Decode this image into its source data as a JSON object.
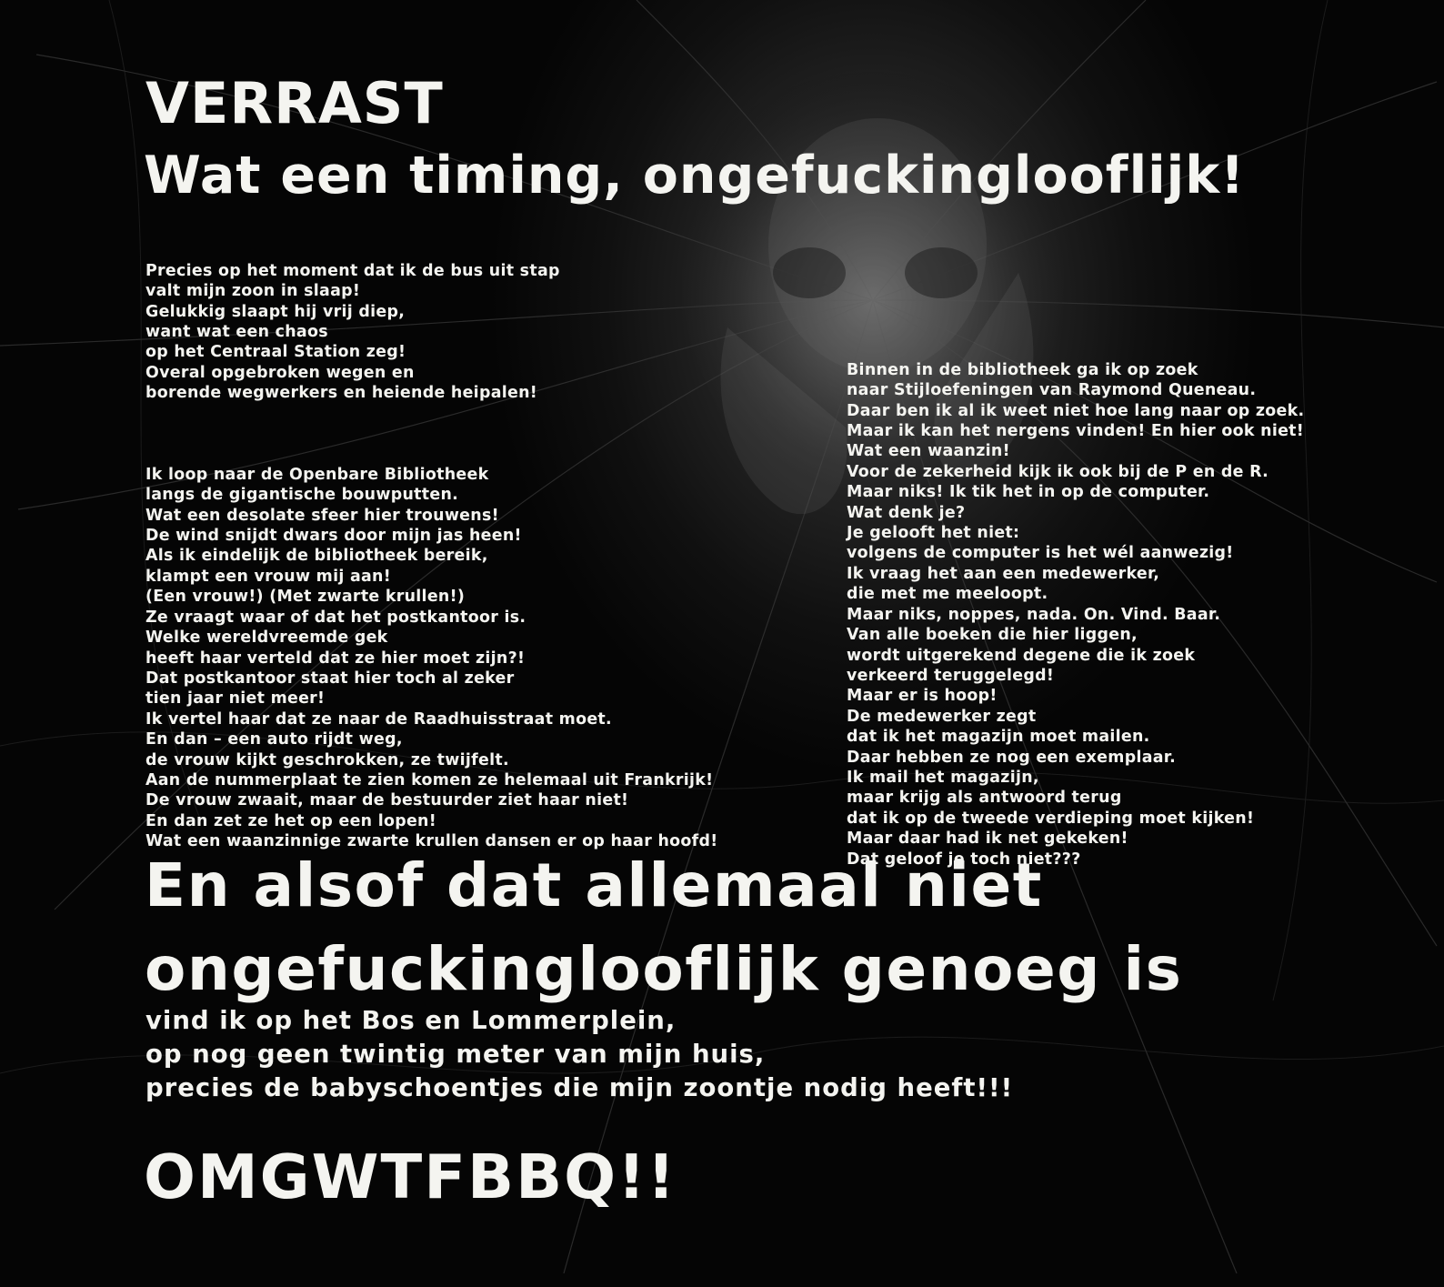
{
  "poster": {
    "kicker": "VERRAST",
    "headline": "Wat een timing, ongefuckinglooflijk!",
    "left_column": [
      "Precies op het moment dat ik de bus uit stap\nvalt mijn zoon in slaap!\nGelukkig slaapt hij vrij diep,\nwant wat een chaos\nop het Centraal Station zeg!\nOveral opgebroken wegen en\nborende wegwerkers en heiende heipalen!",
      "Ik loop naar de Openbare Bibliotheek\nlangs de gigantische bouwputten.\nWat een desolate sfeer hier trouwens!\nDe wind snijdt dwars door mijn jas heen!\nAls ik eindelijk de bibliotheek bereik,\nklampt een vrouw mij aan!\n(Een vrouw!) (Met zwarte krullen!)\nZe vraagt waar of dat het postkantoor is.\nWelke wereldvreemde gek\nheeft haar verteld dat ze hier moet zijn?!\nDat postkantoor staat hier toch al zeker\ntien jaar niet meer!\nIk vertel haar dat ze naar de Raadhuisstraat moet.\nEn dan – een auto rijdt weg,\nde vrouw kijkt geschrokken, ze twijfelt.\nAan de nummerplaat te zien komen ze helemaal uit Frankrijk!\nDe vrouw zwaait, maar de bestuurder ziet haar niet!\nEn dan zet ze het op een lopen!\nWat een waanzinnige zwarte krullen dansen er op haar hoofd!"
    ],
    "right_column": "Binnen in de bibliotheek ga ik op zoek\nnaar Stijloefeningen van Raymond Queneau.\nDaar ben ik al ik weet niet hoe lang naar op zoek.\nMaar ik kan het nergens vinden! En hier ook niet!\nWat een waanzin!\nVoor de zekerheid kijk ik ook bij de P en de R.\nMaar niks! Ik tik het in op de computer.\nWat denk je?\nJe gelooft het niet:\nvolgens de computer is het wél aanwezig!\nIk vraag het aan een medewerker,\ndie met me meeloopt.\nMaar niks, noppes, nada. On. Vind. Baar.\nVan alle boeken die hier liggen,\nwordt uitgerekend degene die ik zoek\nverkeerd teruggelegd!\nMaar er is hoop!\nDe medewerker zegt\ndat ik het magazijn moet mailen.\nDaar hebben ze nog een exemplaar.\nIk mail het magazijn,\nmaar krijg als antwoord terug\ndat ik op de tweede verdieping moet kijken!\nMaar daar had ik net gekeken!\nDat geloof je toch niet???",
    "big_statement": "En alsof dat allemaal niet\nongefuckinglooflijk genoeg is",
    "sub_statement": "vind ik op het Bos en Lommerplein,\nop nog geen twintig meter van mijn huis,\nprecies de babyschoentjes die mijn zoontje nodig heeft!!!",
    "final_shout": "OMGWTFBBQ!!"
  },
  "colors": {
    "background": "#050505",
    "text": "#f4f4f0"
  }
}
